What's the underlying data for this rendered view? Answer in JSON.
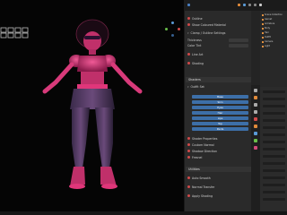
{
  "viewport": {
    "figure_label": "Garnet"
  },
  "header": {
    "tools": [
      "select",
      "move",
      "rotate",
      "scale"
    ]
  },
  "n_panel": {
    "rows": [
      {
        "label": "Outline"
      },
      {
        "label": "Show Coloured Material"
      },
      {
        "label": "Clamp / Outline Settings"
      },
      {
        "label": "Thickness"
      },
      {
        "label": "Color Tint"
      },
      {
        "label": "Line Art"
      },
      {
        "label": "Shading"
      }
    ],
    "section_shaders": "Shaders",
    "section_shaders_sub": "Outfit Set",
    "blue_items": [
      "Base",
      "Skin",
      "Eyes",
      "Hair",
      "Lips",
      "Top",
      "Pants"
    ],
    "more_rows": [
      {
        "label": "Shader Properties"
      },
      {
        "label": "Custom Normal"
      },
      {
        "label": "Shadow Direction"
      },
      {
        "label": "Fresnel"
      }
    ],
    "section_bottom": "Utilities",
    "bottom_rows": [
      {
        "label": "Auto Smooth"
      },
      {
        "label": "Normal Transfer"
      },
      {
        "label": "Apply Shading"
      }
    ]
  },
  "outliner": {
    "items": [
      "Scene Collection",
      "Garnet",
      "Armature",
      "Body",
      "Hair",
      "Outfit",
      "Camera",
      "Light"
    ]
  },
  "colors": {
    "accent": "#3d6fa8",
    "figure_pink": "#e0367a",
    "figure_magenta": "#c02a6a"
  }
}
